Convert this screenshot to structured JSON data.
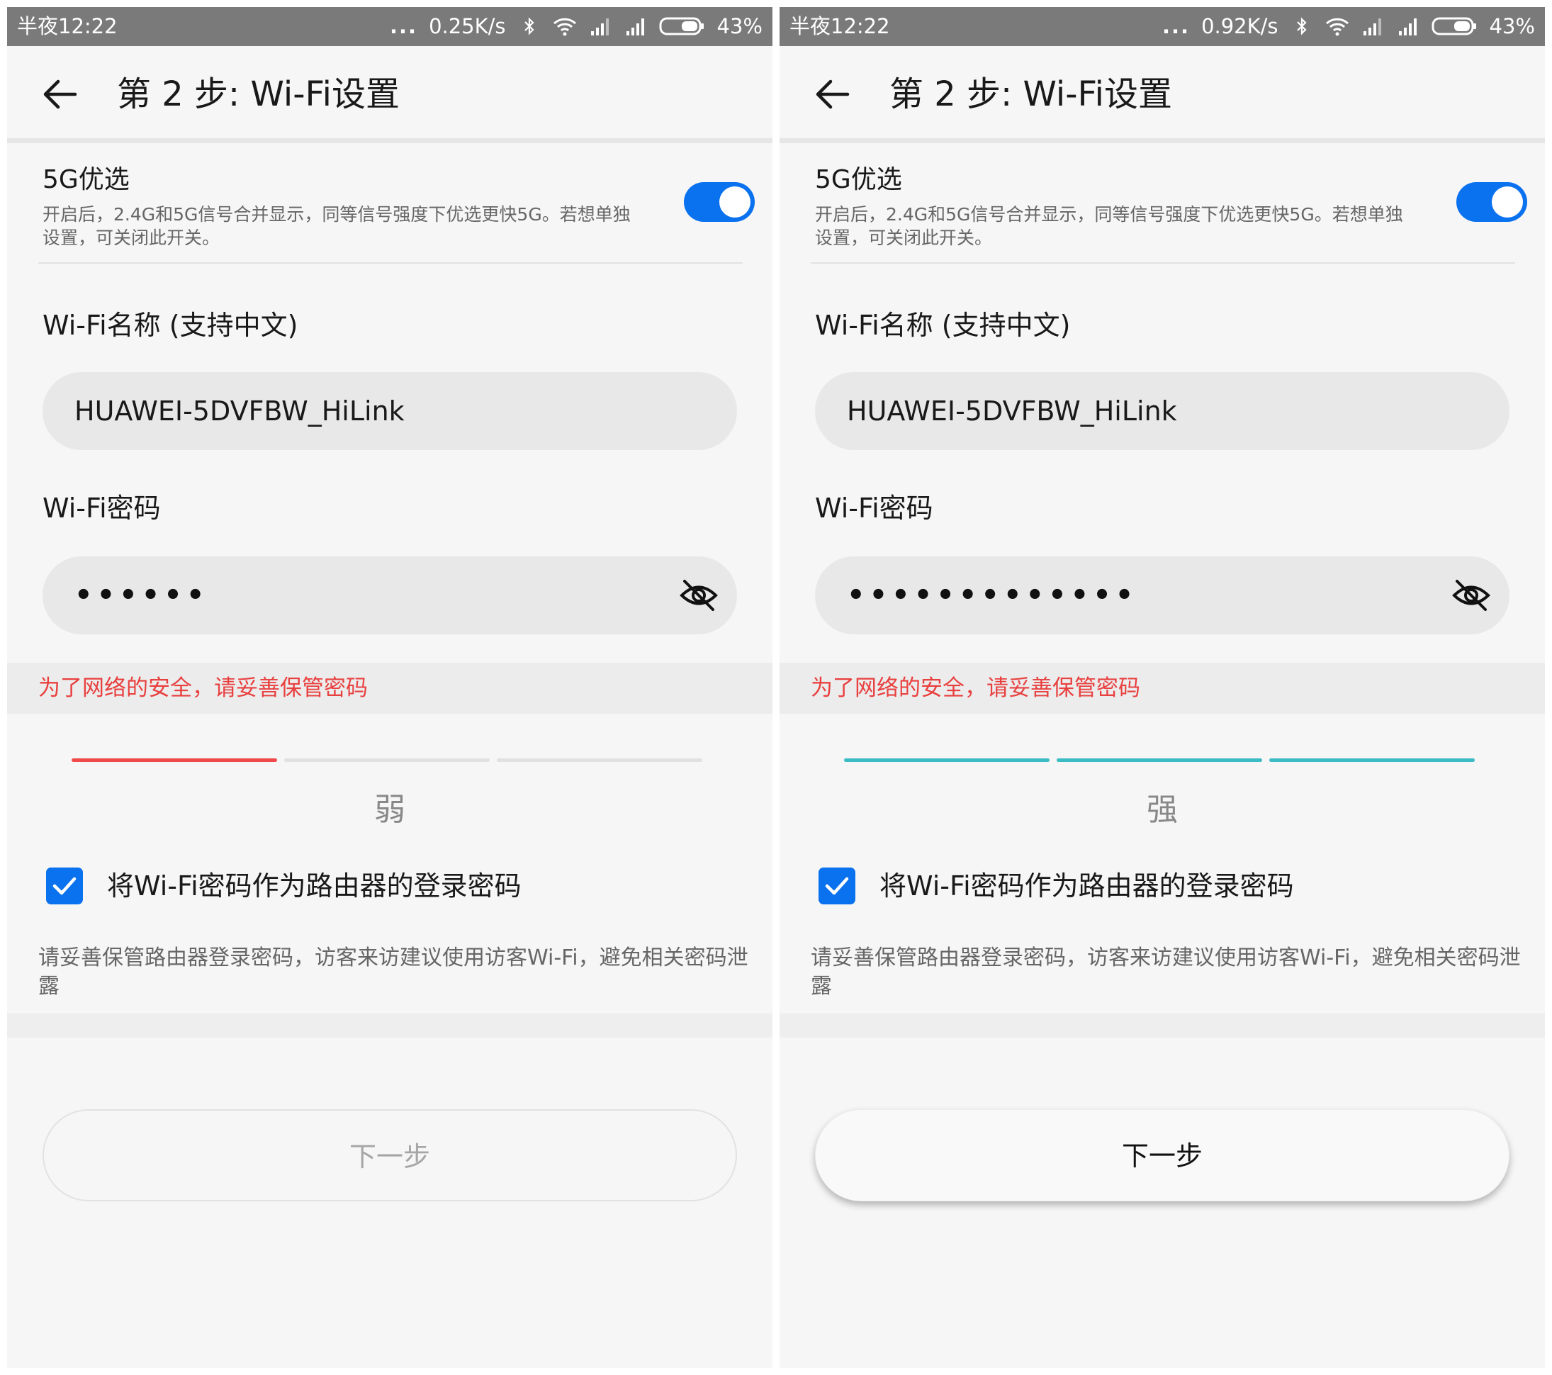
{
  "screens": [
    {
      "status": {
        "time": "半夜12:22",
        "dots": "...",
        "speed": "0.25K/s",
        "battery": "43%"
      },
      "title": "第 2 步: Wi-Fi设置",
      "pref5g": {
        "label": "5G优选",
        "desc": "开启后，2.4G和5G信号合并显示，同等信号强度下优选更快5G。若想单独设置，可关闭此开关。",
        "enabled": true
      },
      "ssid": {
        "label": "Wi-Fi名称 (支持中文)",
        "value": "HUAWEI-5DVFBW_HiLink"
      },
      "password": {
        "label": "Wi-Fi密码",
        "masked": "••••••"
      },
      "warning": "为了网络的安全，请妥善保管密码",
      "strength": {
        "label": "弱",
        "level": 1,
        "of": 3,
        "color": "#f0494a"
      },
      "checkbox": {
        "label": "将Wi-Fi密码作为路由器的登录密码",
        "checked": true
      },
      "note": "请妥善保管路由器登录密码，访客来访建议使用访客Wi-Fi，避免相关密码泄露",
      "next_button": {
        "label": "下一步",
        "enabled": false
      }
    },
    {
      "status": {
        "time": "半夜12:22",
        "dots": "...",
        "speed": "0.92K/s",
        "battery": "43%"
      },
      "title": "第 2 步: Wi-Fi设置",
      "pref5g": {
        "label": "5G优选",
        "desc": "开启后，2.4G和5G信号合并显示，同等信号强度下优选更快5G。若想单独设置，可关闭此开关。",
        "enabled": true
      },
      "ssid": {
        "label": "Wi-Fi名称 (支持中文)",
        "value": "HUAWEI-5DVFBW_HiLink"
      },
      "password": {
        "label": "Wi-Fi密码",
        "masked": "•••••••••••••"
      },
      "warning": "为了网络的安全，请妥善保管密码",
      "strength": {
        "label": "强",
        "level": 3,
        "of": 3,
        "color": "#3bbcc4"
      },
      "checkbox": {
        "label": "将Wi-Fi密码作为路由器的登录密码",
        "checked": true
      },
      "note": "请妥善保管路由器登录密码，访客来访建议使用访客Wi-Fi，避免相关密码泄露",
      "next_button": {
        "label": "下一步",
        "enabled": true
      }
    }
  ],
  "colors": {
    "accent": "#0a71ef",
    "warning": "#e8403f",
    "inactive_bar": "#e1e1e1",
    "status_bar": "#7a7a7a"
  },
  "icons": [
    "back-arrow-icon",
    "bluetooth-icon",
    "wifi-icon",
    "signal-icon",
    "battery-icon",
    "eye-slash-icon",
    "check-icon"
  ]
}
